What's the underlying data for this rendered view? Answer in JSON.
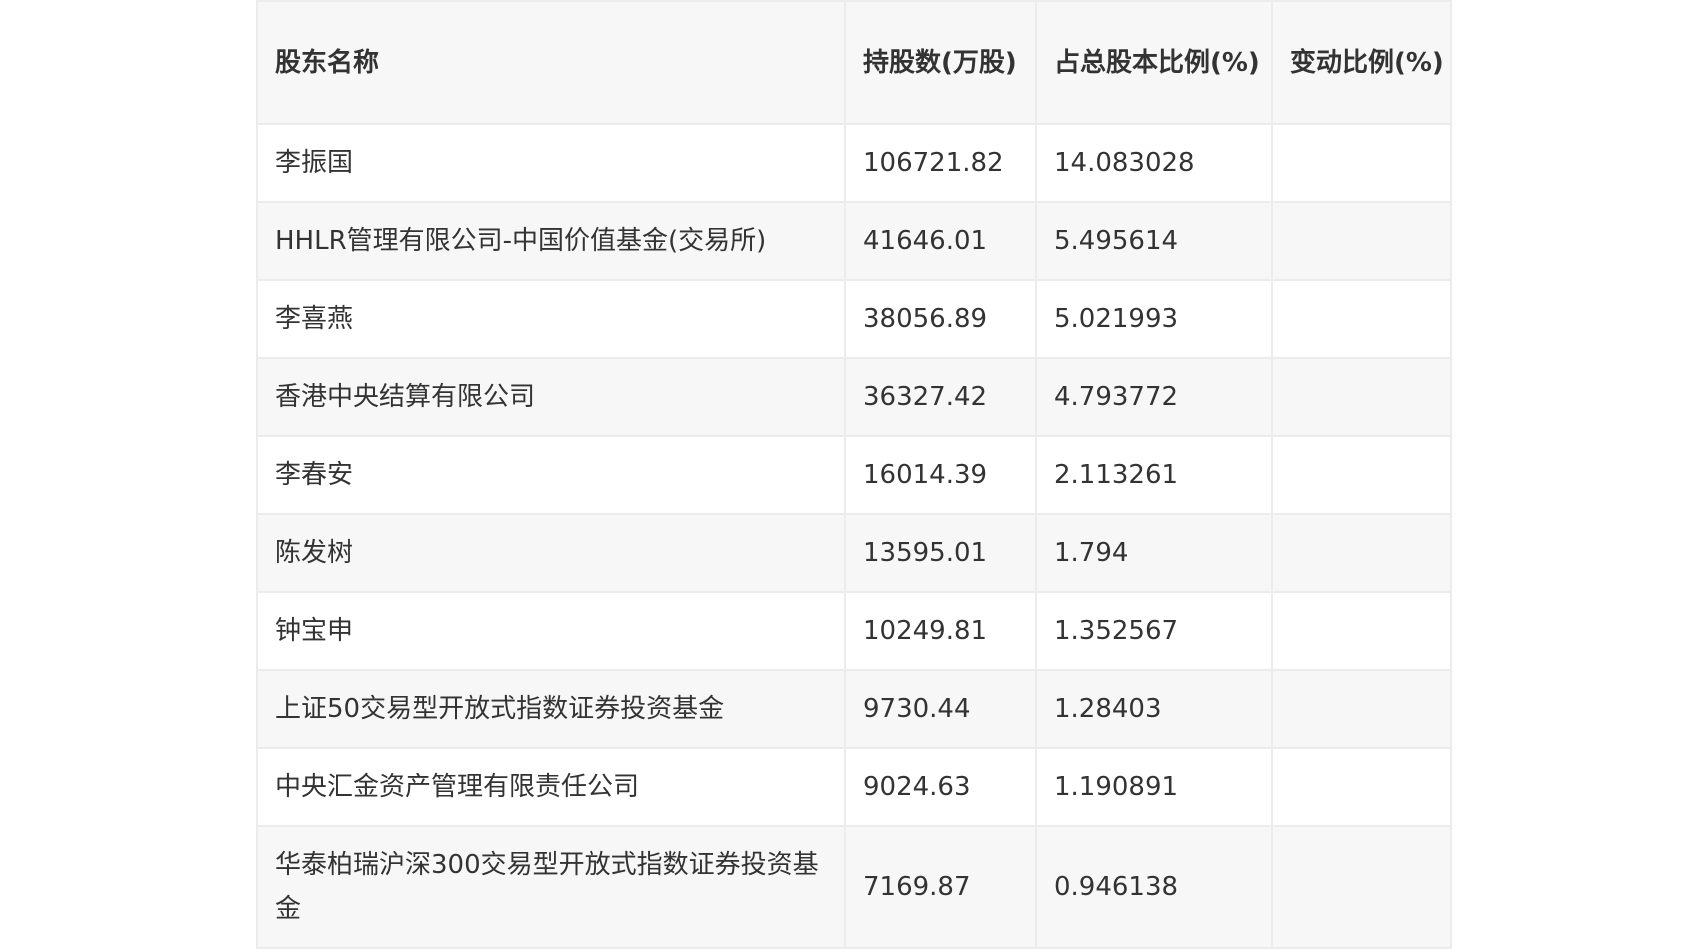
{
  "table": {
    "headers": [
      "股东名称",
      "持股数(万股)",
      "占总股本比例(%)",
      "变动比例(%)"
    ],
    "rows": [
      {
        "name": "李振国",
        "shares": "106721.82",
        "ratio": "14.083028",
        "change": ""
      },
      {
        "name": "HHLR管理有限公司-中国价值基金(交易所)",
        "shares": "41646.01",
        "ratio": "5.495614",
        "change": ""
      },
      {
        "name": "李喜燕",
        "shares": "38056.89",
        "ratio": "5.021993",
        "change": ""
      },
      {
        "name": "香港中央结算有限公司",
        "shares": "36327.42",
        "ratio": "4.793772",
        "change": ""
      },
      {
        "name": "李春安",
        "shares": "16014.39",
        "ratio": "2.113261",
        "change": ""
      },
      {
        "name": "陈发树",
        "shares": "13595.01",
        "ratio": "1.794",
        "change": ""
      },
      {
        "name": "钟宝申",
        "shares": "10249.81",
        "ratio": "1.352567",
        "change": ""
      },
      {
        "name": "上证50交易型开放式指数证券投资基金",
        "shares": "9730.44",
        "ratio": "1.28403",
        "change": ""
      },
      {
        "name": "中央汇金资产管理有限责任公司",
        "shares": "9024.63",
        "ratio": "1.190891",
        "change": ""
      },
      {
        "name": "华泰柏瑞沪深300交易型开放式指数证券投资基金",
        "shares": "7169.87",
        "ratio": "0.946138",
        "change": ""
      }
    ]
  }
}
